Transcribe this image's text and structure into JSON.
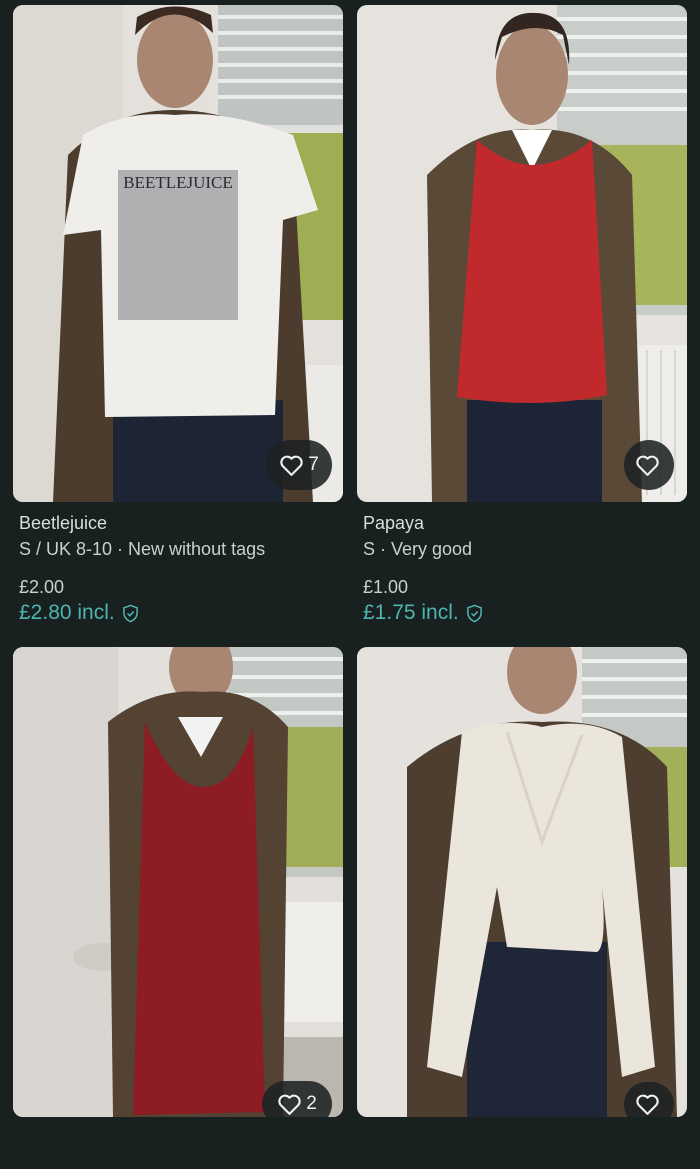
{
  "listings": [
    {
      "title": "Beetlejuice",
      "subtitle": "S / UK 8-10 · New without tags",
      "price": "£2.00",
      "price_incl": "£2.80 incl.",
      "favourites": "7",
      "garment_color": "#efeeea",
      "garment_print": "BEETLEJUICE"
    },
    {
      "title": "Papaya",
      "subtitle": "S · Very good",
      "price": "£1.00",
      "price_incl": "£1.75 incl.",
      "favourites": "",
      "garment_color": "#c12a2c"
    },
    {
      "favourites": "2",
      "garment_color": "#8d1c24"
    },
    {
      "favourites": "",
      "garment_color": "#ebe6dc"
    }
  ],
  "icons": {
    "favourite": "heart-outline-icon",
    "buyer_protection": "shield-check-icon"
  },
  "colors": {
    "background": "#182020",
    "accent": "#4fb5b1"
  }
}
